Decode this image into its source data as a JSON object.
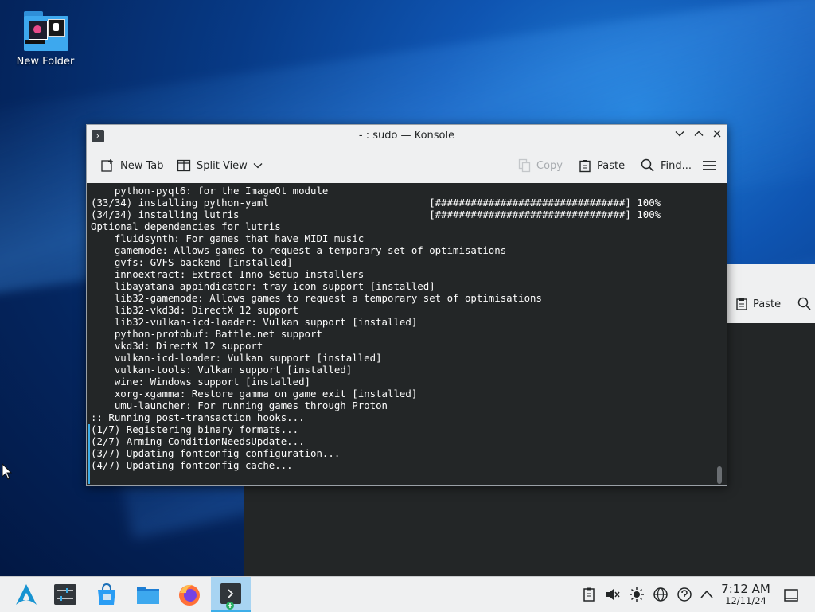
{
  "desktop": {
    "icons": [
      {
        "label": "New Folder"
      }
    ]
  },
  "background_window": {
    "paste_label": "Paste"
  },
  "window": {
    "title": "- : sudo — Konsole",
    "toolbar": {
      "new_tab": "New Tab",
      "split_view": "Split View",
      "copy": "Copy",
      "paste": "Paste",
      "find": "Find..."
    },
    "terminal_lines": [
      "    python-pyqt6: for the ImageQt module",
      "(33/34) installing python-yaml                           [################################] 100%",
      "(34/34) installing lutris                                [################################] 100%",
      "Optional dependencies for lutris",
      "    fluidsynth: For games that have MIDI music",
      "    gamemode: Allows games to request a temporary set of optimisations",
      "    gvfs: GVFS backend [installed]",
      "    innoextract: Extract Inno Setup installers",
      "    libayatana-appindicator: tray icon support [installed]",
      "    lib32-gamemode: Allows games to request a temporary set of optimisations",
      "    lib32-vkd3d: DirectX 12 support",
      "    lib32-vulkan-icd-loader: Vulkan support [installed]",
      "    python-protobuf: Battle.net support",
      "    vkd3d: DirectX 12 support",
      "    vulkan-icd-loader: Vulkan support [installed]",
      "    vulkan-tools: Vulkan support [installed]",
      "    wine: Windows support [installed]",
      "    xorg-xgamma: Restore gamma on game exit [installed]",
      "    umu-launcher: For running games through Proton",
      ":: Running post-transaction hooks...",
      "(1/7) Registering binary formats...",
      "(2/7) Arming ConditionNeedsUpdate...",
      "(3/7) Updating fontconfig configuration...",
      "(4/7) Updating fontconfig cache..."
    ]
  },
  "taskbar": {
    "apps": [
      "app-launcher",
      "system-settings",
      "discover",
      "file-manager",
      "firefox",
      "konsole"
    ],
    "active_app": "konsole",
    "clock": {
      "time": "7:12 AM",
      "date": "12/11/24"
    }
  },
  "colors": {
    "terminal_bg": "#232627",
    "terminal_fg": "#fcfcfc",
    "accent": "#3daee9",
    "panel_bg": "#eff0f1"
  }
}
